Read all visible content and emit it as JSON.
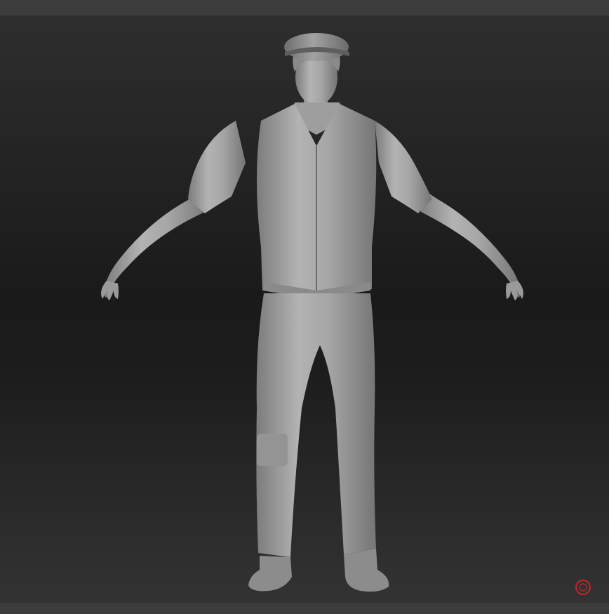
{
  "app": {
    "viewport": {
      "model_name": "",
      "colors": {
        "background_top": "#2e2e2e",
        "background_mid": "#1a1a1a",
        "background_bottom": "#333333",
        "model_clay": "#a9a9a9",
        "model_shadow": "#6a6a6a",
        "gizmo_ring": "#c0282c"
      }
    },
    "icons": {
      "navigation_gizmo": "rotation-gizmo-icon"
    }
  }
}
